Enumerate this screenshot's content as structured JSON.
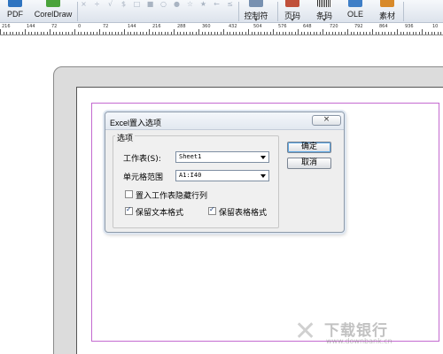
{
  "toolbar": {
    "items": [
      {
        "label": "PDF",
        "icon": "pdf-export-icon",
        "color": "#2f74c0"
      },
      {
        "label": "CorelDraw",
        "icon": "coreldraw-export-icon",
        "color": "#4aa33b"
      },
      {
        "label": "控制符",
        "icon": "control-char-icon",
        "color": "#7790b0"
      },
      {
        "label": "页码",
        "icon": "page-number-icon",
        "color": "#c0503a"
      },
      {
        "label": "条码",
        "icon": "barcode-icon",
        "color": "#333333"
      },
      {
        "label": "OLE",
        "icon": "ole-object-icon",
        "color": "#3f7fc7"
      },
      {
        "label": "素材",
        "icon": "material-icon",
        "color": "#d88a2a"
      }
    ],
    "symbols": [
      "×",
      "÷",
      "√",
      "$",
      "□",
      "■",
      "○",
      "●",
      "☆",
      "★",
      "←",
      "≤"
    ]
  },
  "ruler": {
    "labels": [
      "216",
      "144",
      "72",
      "0",
      "72",
      "144",
      "216",
      "288",
      "360",
      "432",
      "504",
      "576",
      "648",
      "720",
      "792",
      "864",
      "936",
      "10"
    ]
  },
  "dialog": {
    "title": "Excel置入选项",
    "close_label": "×",
    "group_label": "选项",
    "sheet_label": "工作表(S):",
    "sheet_value": "Sheet1",
    "range_label": "单元格范围",
    "range_value": "A1:I40",
    "options": {
      "import_hidden": {
        "label": "置入工作表隐藏行列",
        "checked": false
      },
      "keep_text_format": {
        "label": "保留文本格式",
        "checked": true
      },
      "keep_table_format": {
        "label": "保留表格格式",
        "checked": true
      }
    },
    "ok_label": "确定",
    "cancel_label": "取消"
  },
  "watermark": {
    "text": "下载银行",
    "url": "www.downbank.cn"
  },
  "colors": {
    "margin_guide": "#c46ad0",
    "toolbar_bg": "#e4e9f0",
    "dialog_bg": "#eeeeee"
  }
}
